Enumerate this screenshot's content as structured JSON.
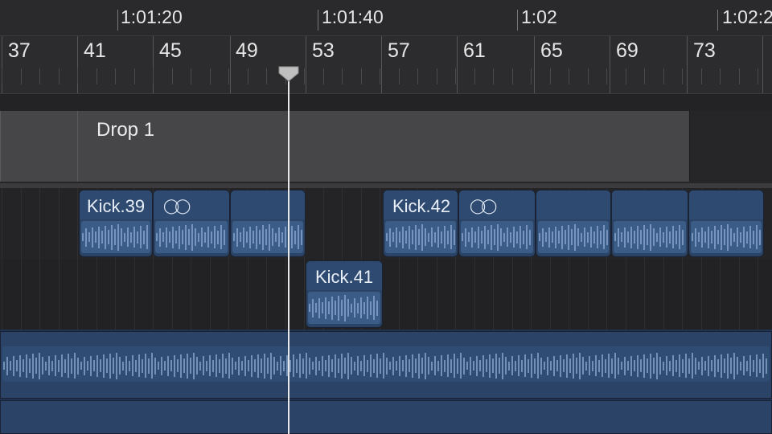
{
  "time_ruler": {
    "labels": [
      "1:01:20",
      "1:01:40",
      "1:02",
      "1:02:2"
    ]
  },
  "bar_ruler": {
    "labels": [
      "37",
      "41",
      "45",
      "49",
      "53",
      "57",
      "61",
      "65",
      "69",
      "73"
    ],
    "highlighted_bar": "41"
  },
  "arrangement": {
    "marker_label": "Drop 1"
  },
  "tracks": {
    "kick_regions": [
      {
        "label": "Kick.39",
        "looped": true
      },
      {
        "label": "Kick.41",
        "looped": false
      },
      {
        "label": "Kick.42",
        "looped": true
      }
    ]
  },
  "icons": {
    "loop": "loop-icon",
    "playhead": "playhead-icon"
  },
  "colors": {
    "region_fill": "#2b4365",
    "region_header": "#2e4a70",
    "waveform": "#8ba7cf",
    "arrangement_block": "#464649",
    "playhead": "#e8e8e8"
  }
}
